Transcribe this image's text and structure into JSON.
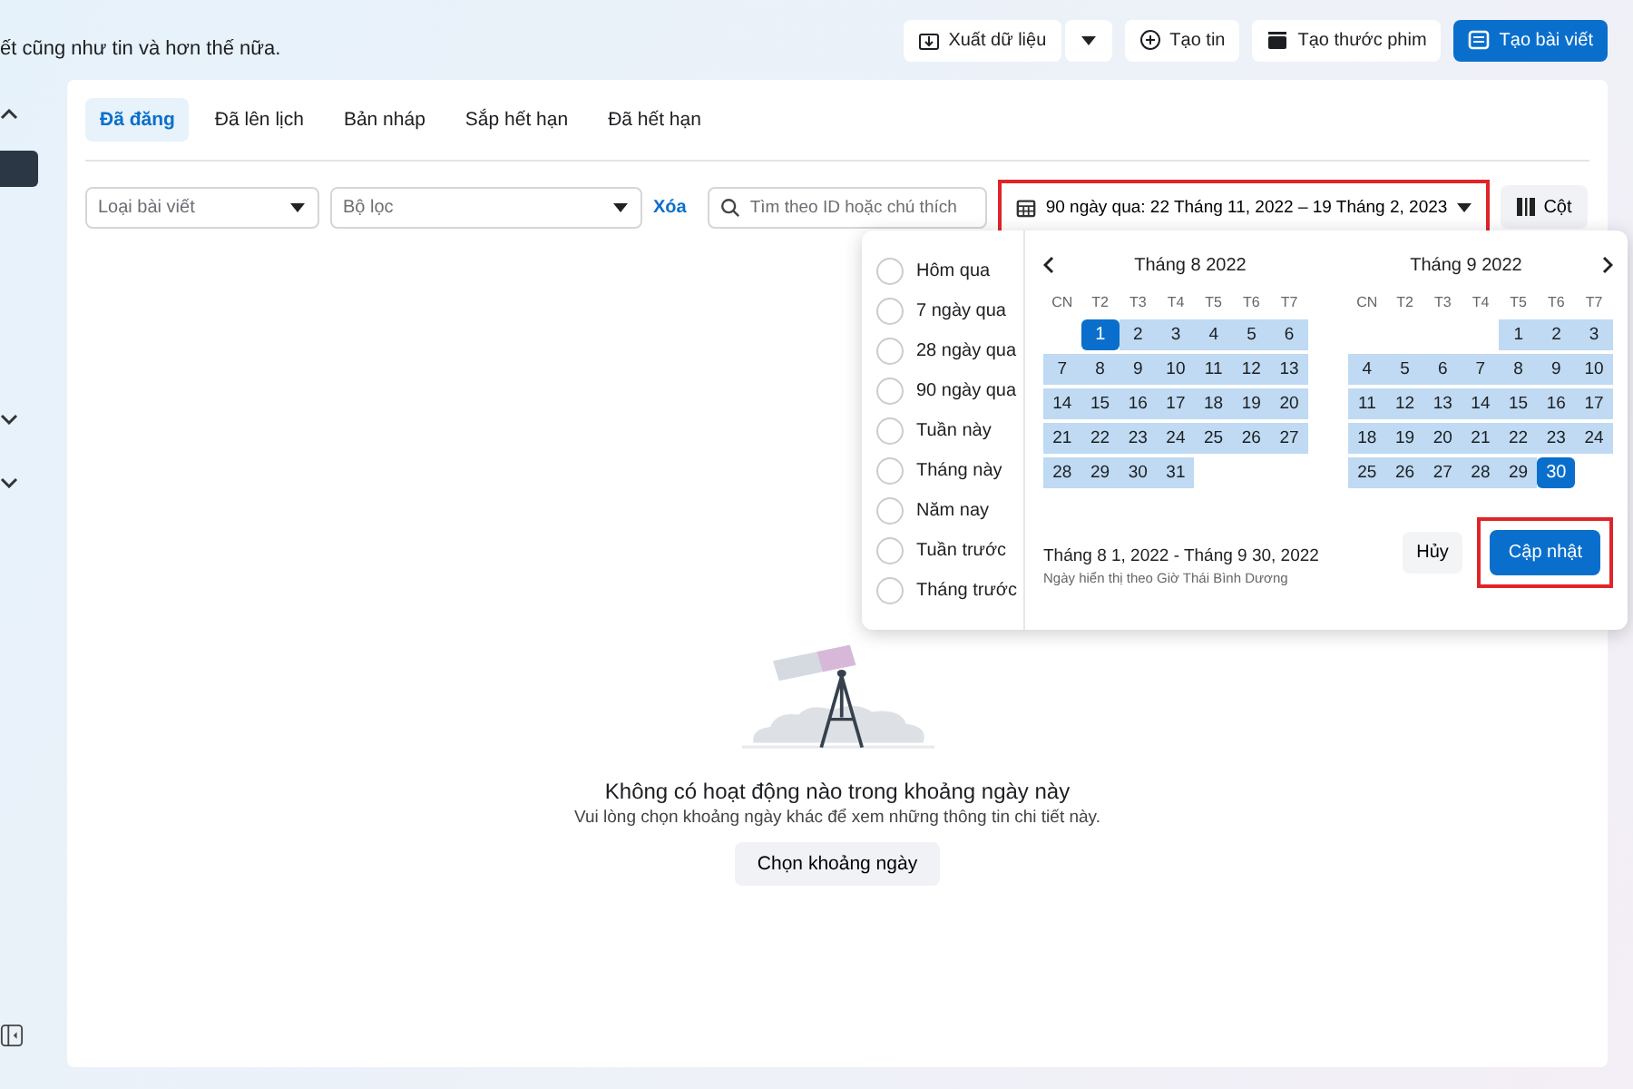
{
  "header": {
    "subtitle": "ết cũng như tin và hơn thế nữa.",
    "buttons": [
      {
        "label": "Xuất dữ liệu",
        "kind": "export",
        "primary": false
      },
      {
        "label": "Tạo tin",
        "kind": "story",
        "primary": false
      },
      {
        "label": "Tạo thước phim",
        "kind": "reel",
        "primary": false
      },
      {
        "label": "Tạo bài viết",
        "kind": "post",
        "primary": true
      }
    ]
  },
  "tabs": [
    {
      "label": "Đã đăng",
      "selected": true
    },
    {
      "label": "Đã lên lịch",
      "selected": false
    },
    {
      "label": "Bản nháp",
      "selected": false
    },
    {
      "label": "Sắp hết hạn",
      "selected": false
    },
    {
      "label": "Đã hết hạn",
      "selected": false
    }
  ],
  "filters": {
    "post_type": {
      "placeholder": "Loại bài viết"
    },
    "filter": {
      "placeholder": "Bộ lọc"
    },
    "clear": "Xóa",
    "search": {
      "placeholder": "Tìm theo ID hoặc chú thích"
    },
    "date_range": {
      "label": "90 ngày qua: 22 Tháng 11, 2022 – 19 Tháng 2, 2023",
      "highlighted": true
    },
    "columns": "Cột"
  },
  "date_picker": {
    "presets": [
      {
        "label": "Hôm qua",
        "selected": false
      },
      {
        "label": "7 ngày qua",
        "selected": false
      },
      {
        "label": "28 ngày qua",
        "selected": false
      },
      {
        "label": "90 ngày qua",
        "selected": false
      },
      {
        "label": "Tuần này",
        "selected": false
      },
      {
        "label": "Tháng này",
        "selected": false
      },
      {
        "label": "Năm nay",
        "selected": false
      },
      {
        "label": "Tuần trước",
        "selected": false
      },
      {
        "label": "Tháng trước",
        "selected": false
      }
    ],
    "months": [
      {
        "title": "Tháng 8 2022",
        "weekdays": [
          "CN",
          "T2",
          "T3",
          "T4",
          "T5",
          "T6",
          "T7"
        ],
        "weeks": [
          {
            "right_aligned": true,
            "days": [
              {
                "day": "1",
                "endpoint": true
              },
              {
                "day": "2",
                "endpoint": false
              },
              {
                "day": "3",
                "endpoint": false
              },
              {
                "day": "4",
                "endpoint": false
              },
              {
                "day": "5",
                "endpoint": false
              },
              {
                "day": "6",
                "endpoint": false
              }
            ]
          },
          {
            "right_aligned": false,
            "days": [
              {
                "day": "7",
                "endpoint": false
              },
              {
                "day": "8",
                "endpoint": false
              },
              {
                "day": "9",
                "endpoint": false
              },
              {
                "day": "10",
                "endpoint": false
              },
              {
                "day": "11",
                "endpoint": false
              },
              {
                "day": "12",
                "endpoint": false
              },
              {
                "day": "13",
                "endpoint": false
              }
            ]
          },
          {
            "right_aligned": false,
            "days": [
              {
                "day": "14",
                "endpoint": false
              },
              {
                "day": "15",
                "endpoint": false
              },
              {
                "day": "16",
                "endpoint": false
              },
              {
                "day": "17",
                "endpoint": false
              },
              {
                "day": "18",
                "endpoint": false
              },
              {
                "day": "19",
                "endpoint": false
              },
              {
                "day": "20",
                "endpoint": false
              }
            ]
          },
          {
            "right_aligned": false,
            "days": [
              {
                "day": "21",
                "endpoint": false
              },
              {
                "day": "22",
                "endpoint": false
              },
              {
                "day": "23",
                "endpoint": false
              },
              {
                "day": "24",
                "endpoint": false
              },
              {
                "day": "25",
                "endpoint": false
              },
              {
                "day": "26",
                "endpoint": false
              },
              {
                "day": "27",
                "endpoint": false
              }
            ]
          },
          {
            "right_aligned": false,
            "days": [
              {
                "day": "28",
                "endpoint": false
              },
              {
                "day": "29",
                "endpoint": false
              },
              {
                "day": "30",
                "endpoint": false
              },
              {
                "day": "31",
                "endpoint": false
              }
            ]
          }
        ]
      },
      {
        "title": "Tháng 9 2022",
        "weekdays": [
          "CN",
          "T2",
          "T3",
          "T4",
          "T5",
          "T6",
          "T7"
        ],
        "weeks": [
          {
            "right_aligned": true,
            "days": [
              {
                "day": "1",
                "endpoint": false
              },
              {
                "day": "2",
                "endpoint": false
              },
              {
                "day": "3",
                "endpoint": false
              }
            ]
          },
          {
            "right_aligned": false,
            "days": [
              {
                "day": "4",
                "endpoint": false
              },
              {
                "day": "5",
                "endpoint": false
              },
              {
                "day": "6",
                "endpoint": false
              },
              {
                "day": "7",
                "endpoint": false
              },
              {
                "day": "8",
                "endpoint": false
              },
              {
                "day": "9",
                "endpoint": false
              },
              {
                "day": "10",
                "endpoint": false
              }
            ]
          },
          {
            "right_aligned": false,
            "days": [
              {
                "day": "11",
                "endpoint": false
              },
              {
                "day": "12",
                "endpoint": false
              },
              {
                "day": "13",
                "endpoint": false
              },
              {
                "day": "14",
                "endpoint": false
              },
              {
                "day": "15",
                "endpoint": false
              },
              {
                "day": "16",
                "endpoint": false
              },
              {
                "day": "17",
                "endpoint": false
              }
            ]
          },
          {
            "right_aligned": false,
            "days": [
              {
                "day": "18",
                "endpoint": false
              },
              {
                "day": "19",
                "endpoint": false
              },
              {
                "day": "20",
                "endpoint": false
              },
              {
                "day": "21",
                "endpoint": false
              },
              {
                "day": "22",
                "endpoint": false
              },
              {
                "day": "23",
                "endpoint": false
              },
              {
                "day": "24",
                "endpoint": false
              }
            ]
          },
          {
            "right_aligned": false,
            "days": [
              {
                "day": "25",
                "endpoint": false
              },
              {
                "day": "26",
                "endpoint": false
              },
              {
                "day": "27",
                "endpoint": false
              },
              {
                "day": "28",
                "endpoint": false
              },
              {
                "day": "29",
                "endpoint": false
              },
              {
                "day": "30",
                "endpoint": true
              }
            ]
          }
        ]
      }
    ],
    "range_text": "Tháng 8 1, 2022 - Tháng 9 30, 2022",
    "timezone_note": "Ngày hiển thị theo Giờ Thái Bình Dương",
    "cancel": "Hủy",
    "update": {
      "label": "Cập nhật",
      "highlighted": true
    }
  },
  "empty_state": {
    "title": "Không có hoạt động nào trong khoảng ngày này",
    "message": "Vui lòng chọn khoảng ngày khác để xem những thông tin chi tiết này.",
    "button": "Chọn khoảng ngày"
  }
}
